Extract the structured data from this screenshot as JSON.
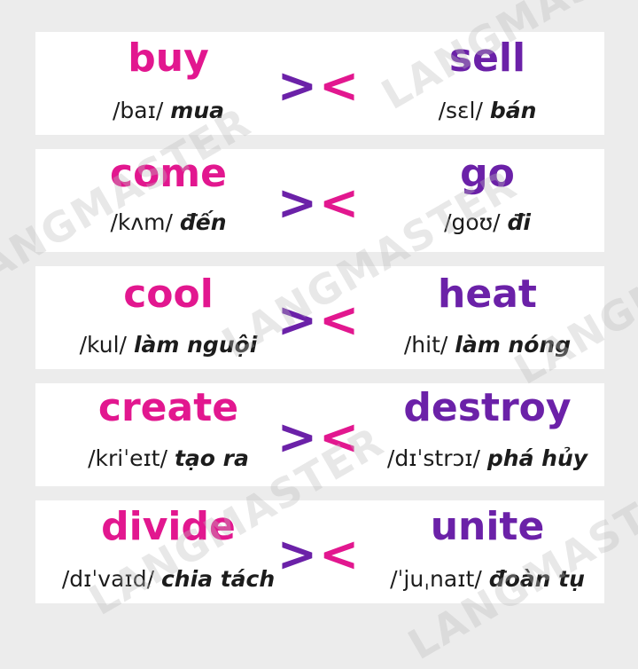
{
  "watermark": "LANGMASTER",
  "pairs": [
    {
      "left": {
        "word": "buy",
        "ipa": "/baɪ/",
        "meaning": "mua"
      },
      "right": {
        "word": "sell",
        "ipa": "/sɛl/",
        "meaning": "bán"
      }
    },
    {
      "left": {
        "word": "come",
        "ipa": "/kʌm/",
        "meaning": "đến"
      },
      "right": {
        "word": "go",
        "ipa": "/goʊ/",
        "meaning": "đi"
      }
    },
    {
      "left": {
        "word": "cool",
        "ipa": "/kul/",
        "meaning": "làm nguội"
      },
      "right": {
        "word": "heat",
        "ipa": "/hit/",
        "meaning": "làm nóng"
      }
    },
    {
      "left": {
        "word": "create",
        "ipa": "/kriˈeɪt/",
        "meaning": "tạo ra"
      },
      "right": {
        "word": "destroy",
        "ipa": "/dɪˈstrɔɪ/",
        "meaning": "phá hủy"
      }
    },
    {
      "left": {
        "word": "divide",
        "ipa": "/dɪˈvaɪd/",
        "meaning": "chia tách"
      },
      "right": {
        "word": "unite",
        "ipa": "/ˈjuˌnaɪt/",
        "meaning": "đoàn tụ"
      }
    }
  ],
  "separator": {
    "gt": ">",
    "lt": "<"
  },
  "colors": {
    "left_word": "#e2178f",
    "right_word": "#6b21a8",
    "background": "#ececec",
    "card": "#ffffff"
  }
}
